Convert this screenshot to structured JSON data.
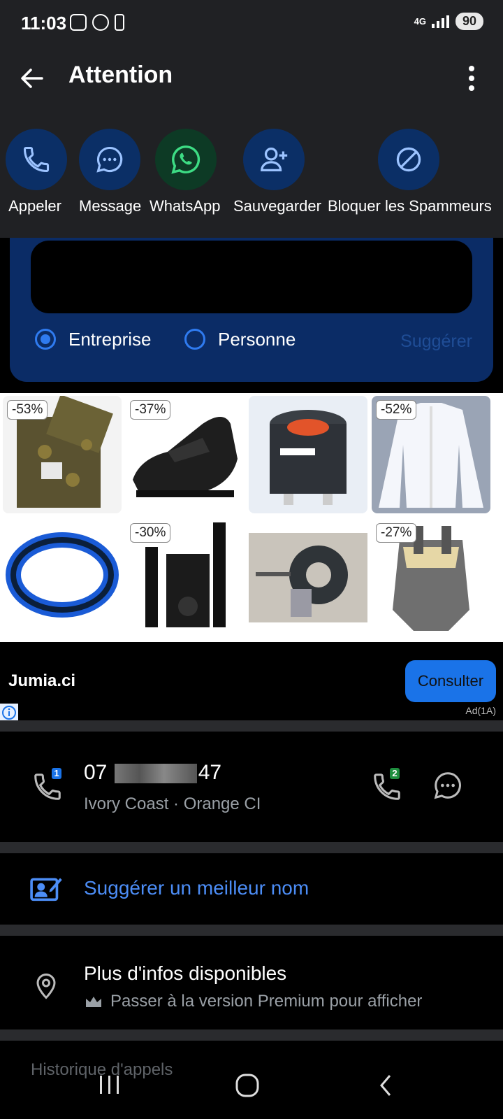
{
  "status": {
    "time": "11:03",
    "network": "4G",
    "battery": "90"
  },
  "header": {
    "title": "Attention"
  },
  "actions": [
    {
      "label": "Appeler",
      "icon": "phone-icon"
    },
    {
      "label": "Message",
      "icon": "message-icon"
    },
    {
      "label": "WhatsApp",
      "icon": "whatsapp-icon"
    },
    {
      "label": "Sauvegarder",
      "icon": "add-contact-icon"
    },
    {
      "label": "Bloquer les Spammeurs",
      "icon": "block-icon"
    }
  ],
  "suggest": {
    "option1": "Entreprise",
    "option2": "Personne",
    "selected": "Entreprise",
    "button": "Suggérer"
  },
  "ad": {
    "products": [
      {
        "discount": "-53%",
        "name": "fabric"
      },
      {
        "discount": "-37%",
        "name": "shoe"
      },
      {
        "discount": "",
        "name": "stove"
      },
      {
        "discount": "-52%",
        "name": "shirt"
      },
      {
        "discount": "",
        "name": "ring"
      },
      {
        "discount": "-30%",
        "name": "speaker"
      },
      {
        "discount": "",
        "name": "burner"
      },
      {
        "discount": "-27%",
        "name": "baby-carrier"
      }
    ],
    "brand": "Jumia.ci",
    "cta": "Consulter",
    "label": "Ad(1A)"
  },
  "number": {
    "prefix": "07 ",
    "suffix": "47",
    "sub": "Ivory Coast · Orange CI",
    "sim1": "1",
    "sim2": "2"
  },
  "suggest_name": "Suggérer un meilleur nom",
  "more_info": {
    "title": "Plus d'infos disponibles",
    "subtitle": "Passer à la version Premium pour afficher"
  },
  "history": "Historique d'appels",
  "colors": {
    "accent": "#2f7bf0",
    "header_bg": "#202124",
    "action_circle": "#0b2f66",
    "whatsapp_circle": "#0d3a25"
  }
}
